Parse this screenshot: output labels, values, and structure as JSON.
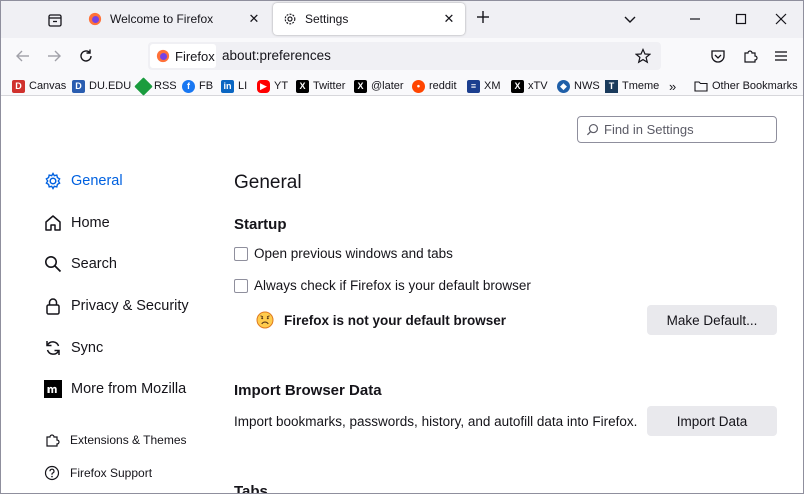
{
  "tabs": [
    {
      "label": "Welcome to Firefox",
      "close": "✕"
    },
    {
      "label": "Settings",
      "close": "✕"
    }
  ],
  "navbar": {
    "identity_label": "Firefox",
    "url": "about:preferences"
  },
  "bookmarks": [
    {
      "label": "Canvas",
      "icon": "canvas-icon",
      "color": "#d0312d"
    },
    {
      "label": "DU.EDU",
      "icon": "du-icon",
      "color": "#2a5db0"
    },
    {
      "label": "RSS",
      "icon": "rss-icon",
      "color": "#1a9c3e"
    },
    {
      "label": "FB",
      "icon": "facebook-icon",
      "color": "#1877f2"
    },
    {
      "label": "LI",
      "icon": "linkedin-icon",
      "color": "#0a66c2"
    },
    {
      "label": "YT",
      "icon": "youtube-icon",
      "color": "#ff0000"
    },
    {
      "label": "Twitter",
      "icon": "x-icon",
      "color": "#000000"
    },
    {
      "label": "@later",
      "icon": "x-icon",
      "color": "#000000"
    },
    {
      "label": "reddit",
      "icon": "reddit-icon",
      "color": "#ff4500"
    },
    {
      "label": "XM",
      "icon": "xm-icon",
      "color": "#1c3f8f"
    },
    {
      "label": "xTV",
      "icon": "x-icon",
      "color": "#000000"
    },
    {
      "label": "NWS",
      "icon": "nws-icon",
      "color": "#1f5fa8"
    },
    {
      "label": "Tmeme",
      "icon": "tmeme-icon",
      "color": "#1a3b5c"
    }
  ],
  "other_bookmarks": "Other Bookmarks",
  "search": {
    "placeholder": "Find in Settings"
  },
  "sidebar": {
    "items": [
      {
        "label": "General",
        "icon": "gear-icon"
      },
      {
        "label": "Home",
        "icon": "home-icon"
      },
      {
        "label": "Search",
        "icon": "search-icon"
      },
      {
        "label": "Privacy & Security",
        "icon": "lock-icon"
      },
      {
        "label": "Sync",
        "icon": "sync-icon"
      },
      {
        "label": "More from Mozilla",
        "icon": "mozilla-icon"
      }
    ],
    "footer": [
      {
        "label": "Extensions & Themes",
        "icon": "puzzle-icon"
      },
      {
        "label": "Firefox Support",
        "icon": "help-icon"
      }
    ]
  },
  "main": {
    "title": "General",
    "startup": {
      "heading": "Startup",
      "opt_restore": "Open previous windows and tabs",
      "opt_default_check": "Always check if Firefox is your default browser",
      "default_status": "Firefox is not your default browser",
      "make_default": "Make Default..."
    },
    "import": {
      "heading": "Import Browser Data",
      "description": "Import bookmarks, passwords, history, and autofill data into Firefox.",
      "button": "Import Data"
    },
    "tabs_heading": "Tabs"
  },
  "colors": {
    "accent": "#0061e0",
    "chrome": "#f0f0f4",
    "button": "#e9e9ed"
  }
}
